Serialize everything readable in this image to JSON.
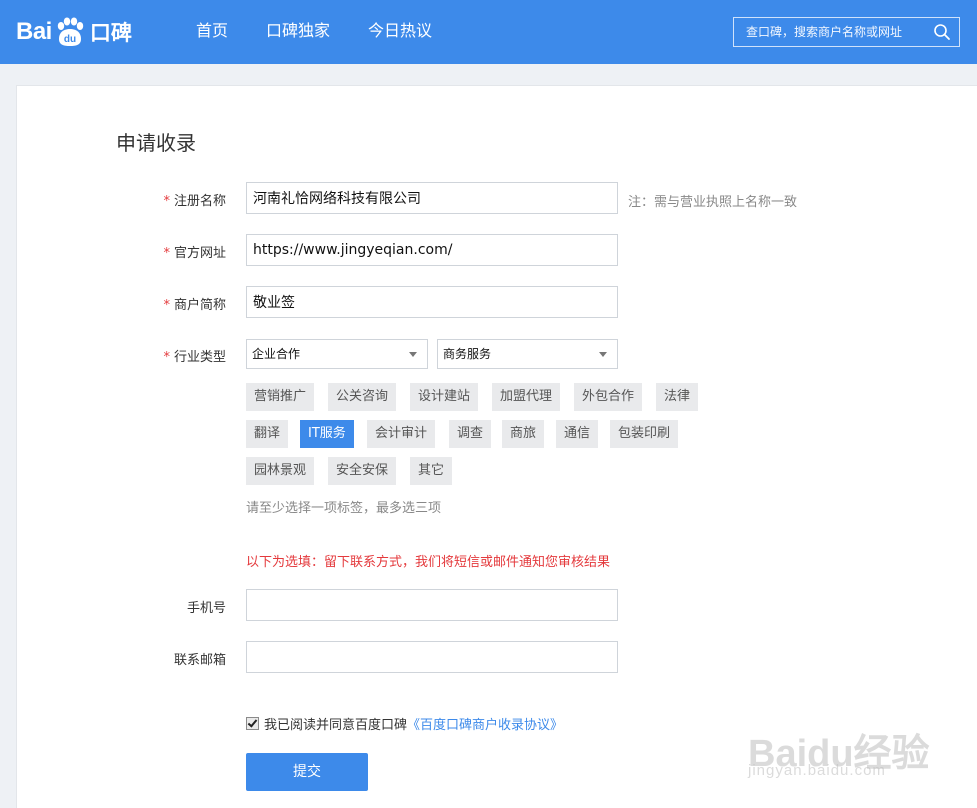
{
  "header": {
    "logo_left": "Bai",
    "logo_paw": "du",
    "logo_right": "口碑",
    "nav": [
      "首页",
      "口碑独家",
      "今日热议"
    ],
    "search_placeholder": "查口碑，搜索商户名称或网址"
  },
  "form": {
    "title": "申请收录",
    "required_mark": "*",
    "reg_name_label": "注册名称",
    "reg_name_value": "河南礼恰网络科技有限公司",
    "reg_name_hint": "注：需与营业执照上名称一致",
    "website_label": "官方网址",
    "website_value": "https://www.jingyeqian.com/",
    "short_name_label": "商户简称",
    "short_name_value": "敬业签",
    "industry_label": "行业类型",
    "industry_primary": "企业合作",
    "industry_secondary": "商务服务",
    "tags": [
      "营销推广",
      "公关咨询",
      "设计建站",
      "加盟代理",
      "外包合作",
      "法律",
      "翻译",
      "IT服务",
      "会计审计",
      "调查",
      "商旅",
      "通信",
      "包装印刷",
      "园林景观",
      "安全安保",
      "其它"
    ],
    "selected_tag": "IT服务",
    "tag_tip": "请至少选择一项标签，最多选三项",
    "optional_note": "以下为选填：留下联系方式，我们将短信或邮件通知您审核结果",
    "phone_label": "手机号",
    "phone_value": "",
    "email_label": "联系邮箱",
    "email_value": "",
    "agree_checked": true,
    "agree_text": "我已阅读并同意百度口碑",
    "agree_link": "《百度口碑商户收录协议》",
    "submit_label": "提交"
  },
  "watermark": {
    "main": "Baidu经验",
    "sub": "jingyan.baidu.com"
  },
  "colors": {
    "brand_blue": "#3d8aea",
    "required_red": "#e4393c",
    "tag_gray": "#e9eaec"
  }
}
